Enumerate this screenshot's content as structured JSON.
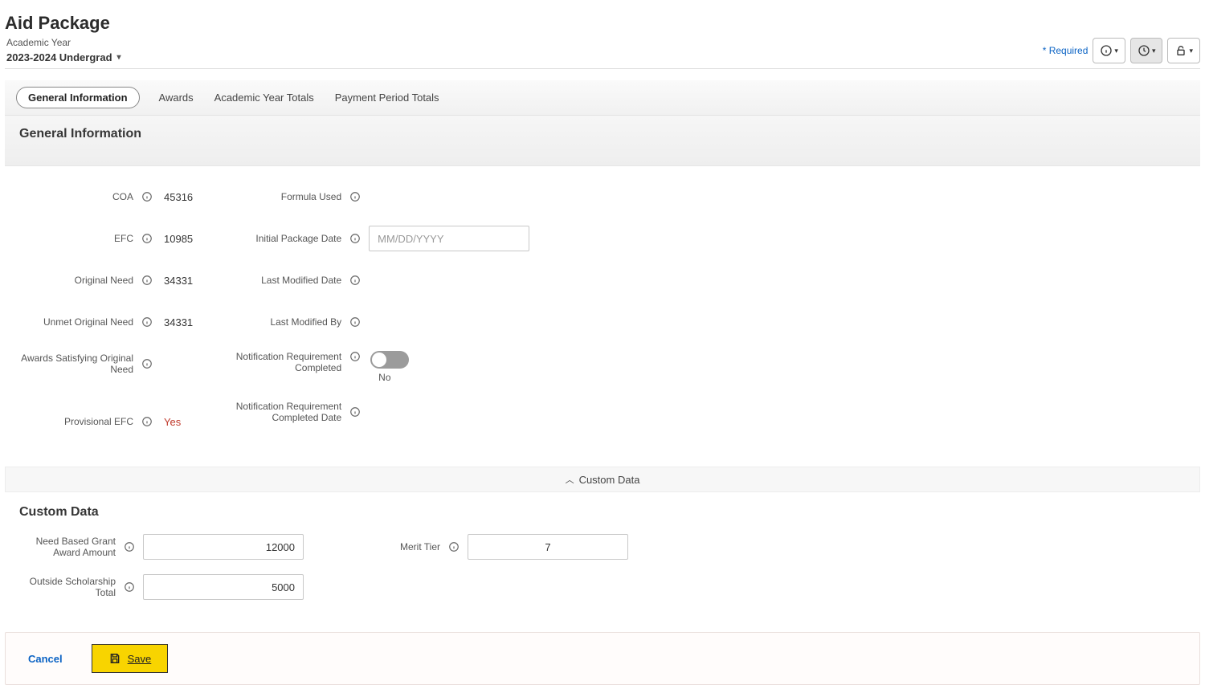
{
  "page_title": "Aid Package",
  "academic_year": {
    "label": "Academic Year",
    "selected": "2023-2024 Undergrad"
  },
  "header": {
    "required_text": "* Required"
  },
  "tabs": [
    {
      "label": "General Information",
      "active": true
    },
    {
      "label": "Awards",
      "active": false
    },
    {
      "label": "Academic Year Totals",
      "active": false
    },
    {
      "label": "Payment Period Totals",
      "active": false
    }
  ],
  "section": {
    "general_info_heading": "General Information"
  },
  "fields_left": {
    "coa": {
      "label": "COA",
      "value": "45316"
    },
    "efc": {
      "label": "EFC",
      "value": "10985"
    },
    "original_need": {
      "label": "Original Need",
      "value": "34331"
    },
    "unmet_original_need": {
      "label": "Unmet Original Need",
      "value": "34331"
    },
    "awards_satisfying": {
      "label": "Awards Satisfying Original Need",
      "value": ""
    },
    "provisional_efc": {
      "label": "Provisional EFC",
      "value": "Yes"
    }
  },
  "fields_right": {
    "formula_used": {
      "label": "Formula Used",
      "value": ""
    },
    "initial_package_date": {
      "label": "Initial Package Date",
      "placeholder": "MM/DD/YYYY",
      "value": ""
    },
    "last_modified_date": {
      "label": "Last Modified Date",
      "value": ""
    },
    "last_modified_by": {
      "label": "Last Modified By",
      "value": ""
    },
    "notification_req": {
      "label": "Notification Requirement Completed",
      "state": "No"
    },
    "notification_req_date": {
      "label": "Notification Requirement Completed Date",
      "value": ""
    }
  },
  "accordion": {
    "custom_data": "Custom Data"
  },
  "custom": {
    "heading": "Custom Data",
    "need_based": {
      "label": "Need Based Grant Award Amount",
      "value": "12000"
    },
    "outside_scholarship": {
      "label": "Outside Scholarship Total",
      "value": "5000"
    },
    "merit_tier": {
      "label": "Merit Tier",
      "value": "7"
    }
  },
  "footer": {
    "cancel": "Cancel",
    "save": "Save"
  }
}
